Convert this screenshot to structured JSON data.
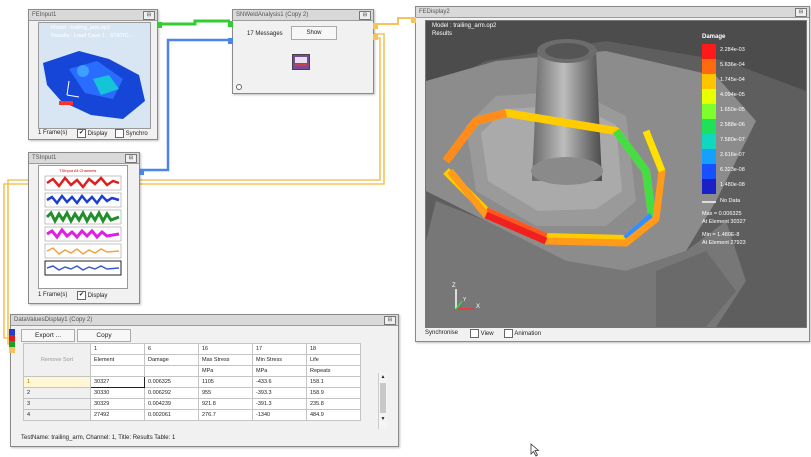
{
  "fe_input": {
    "title": "FEInput1",
    "model": "Model : trailing_arm.op2",
    "results": "Results : Load Case 1 : STATIC...",
    "frames": "1 Frame(s)",
    "display_label": "Display",
    "synchro_label": "Synchro"
  },
  "ts_input": {
    "title": "TSInput1",
    "plot_title": "TSInput All Channels",
    "frames": "1 Frame(s)",
    "display_label": "Display"
  },
  "sn_analysis": {
    "title": "SNWeldAnalysis1 (Copy 2)",
    "messages": "17 Messages",
    "show_label": "Show"
  },
  "fe_display": {
    "title": "FEDisplay2",
    "model": "Model : trailing_arm.op2",
    "results": "Results",
    "legend_title": "Damage",
    "legend_values": [
      "2.284e-03",
      "5.636e-04",
      "1.745e-04",
      "4.094e-05",
      "1.650e-05",
      "2.588e-06",
      "7.580e-07",
      "2.616e-07",
      "6.323e-08",
      "1.480e-08"
    ],
    "no_data": "No Data",
    "max": "Max = 0.006325",
    "max_element": "At Element 30327",
    "min": "Min = 1.480E-8",
    "min_element": "At Element 27923",
    "axis_x": "X",
    "axis_y": "Y",
    "axis_z": "Z",
    "synchronise": "Synchronise",
    "view_label": "View",
    "animation_label": "Animation"
  },
  "data_values": {
    "title": "DataValuesDisplay1 (Copy 2)",
    "export_label": "Export ...",
    "copy_label": "Copy",
    "remove_label": "Remove Sort",
    "col_numbers": [
      "1",
      "6",
      "16",
      "17",
      "18"
    ],
    "headers": [
      "Element",
      "Damage",
      "Max Stress",
      "Min Stress",
      "Life"
    ],
    "units": [
      "",
      "",
      "MPa",
      "MPa",
      "Repeats"
    ],
    "rows": [
      {
        "n": "1",
        "cells": [
          "30327",
          "0.006325",
          "1105",
          "-433.6",
          "158.1"
        ]
      },
      {
        "n": "2",
        "cells": [
          "30330",
          "0.006292",
          "955",
          "-393.3",
          "158.9"
        ]
      },
      {
        "n": "3",
        "cells": [
          "30329",
          "0.004239",
          "921.8",
          "-391.3",
          "235.8"
        ]
      },
      {
        "n": "4",
        "cells": [
          "27492",
          "0.002061",
          "276.7",
          "-1340",
          "484.9"
        ]
      }
    ],
    "footer": "TestName: trailing_arm, Channel: 1, Title: Results Table: 1"
  },
  "colors": {
    "canvas": "#ffffff",
    "wire_green": "#33cc33",
    "wire_blue": "#4a86e8",
    "wire_orange": "#f5c35c"
  }
}
